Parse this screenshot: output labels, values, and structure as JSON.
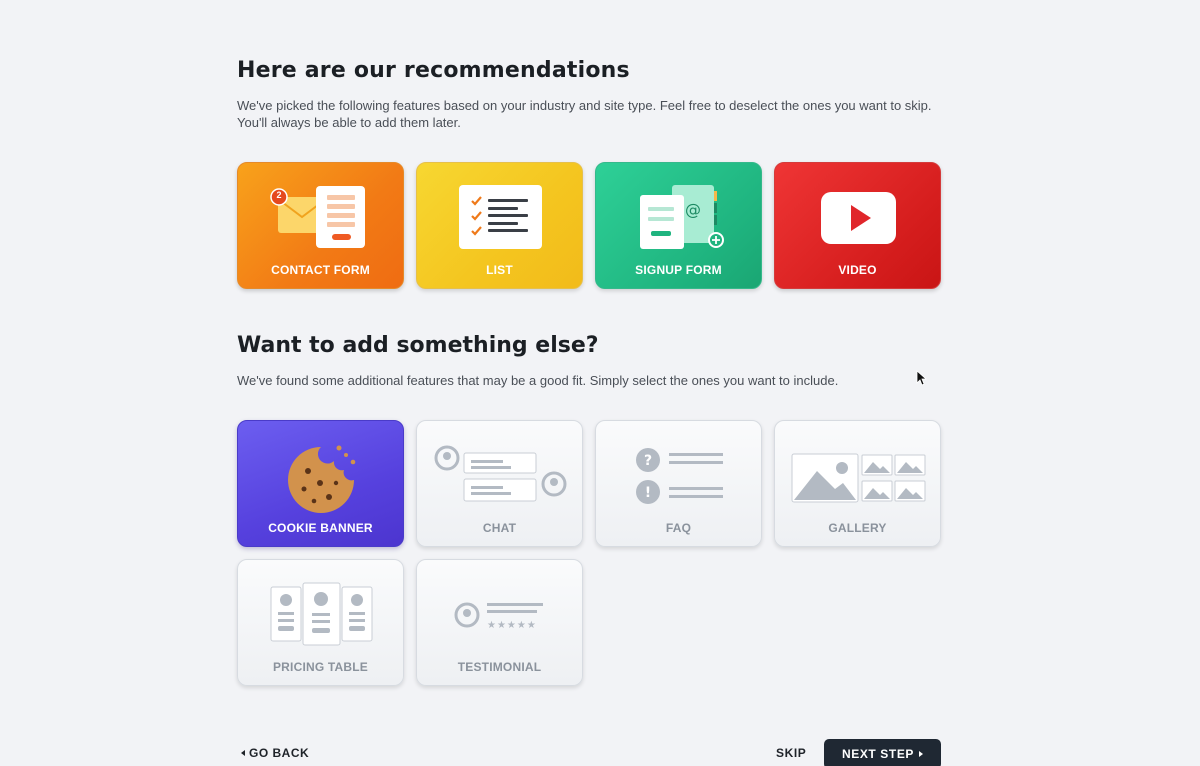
{
  "recommendations": {
    "title": "Here are our recommendations",
    "description": "We've picked the following features based on your industry and site type. Feel free to deselect the ones you want to skip. You'll always be able to add them later.",
    "cards": [
      {
        "label": "CONTACT FORM",
        "icon": "contact-form-icon",
        "color": "#f27a15",
        "badge": "2"
      },
      {
        "label": "LIST",
        "icon": "list-icon",
        "color": "#f4c51f"
      },
      {
        "label": "SIGNUP FORM",
        "icon": "signup-form-icon",
        "color": "#1fb47f"
      },
      {
        "label": "VIDEO",
        "icon": "video-icon",
        "color": "#d51d1d"
      }
    ]
  },
  "additional": {
    "title": "Want to add something else?",
    "description": "We've found some additional features that may be a good fit. Simply select the ones you want to include.",
    "cards": [
      {
        "label": "COOKIE BANNER",
        "icon": "cookie-icon",
        "selected": true,
        "color": "#5641de"
      },
      {
        "label": "CHAT",
        "icon": "chat-icon",
        "selected": false
      },
      {
        "label": "FAQ",
        "icon": "faq-icon",
        "selected": false
      },
      {
        "label": "GALLERY",
        "icon": "gallery-icon",
        "selected": false
      },
      {
        "label": "PRICING TABLE",
        "icon": "pricing-table-icon",
        "selected": false
      },
      {
        "label": "TESTIMONIAL",
        "icon": "testimonial-icon",
        "selected": false
      }
    ]
  },
  "footer": {
    "back_label": "GO BACK",
    "skip_label": "SKIP",
    "next_label": "NEXT STEP",
    "next_color": "#1f2833"
  }
}
